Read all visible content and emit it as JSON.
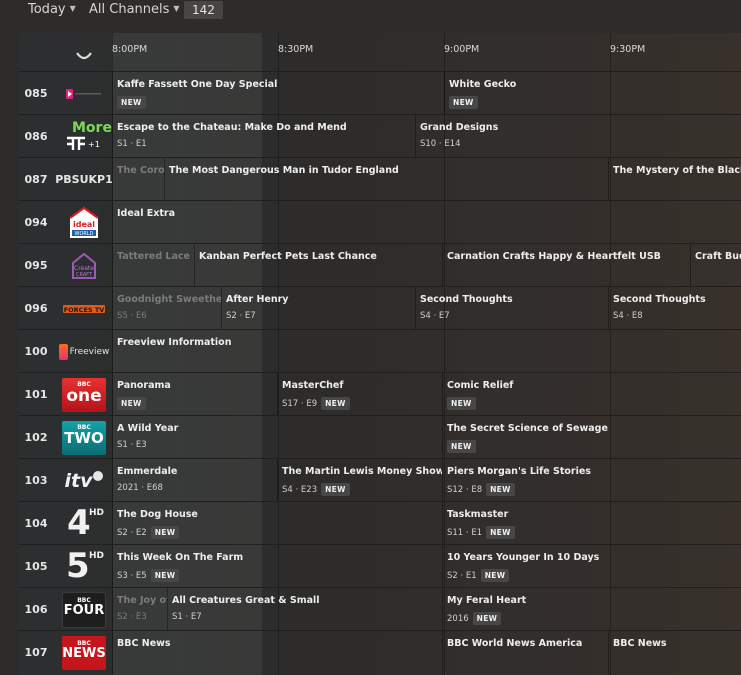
{
  "toolbar": {
    "day_label": "Today",
    "channels_label": "All Channels",
    "channel_count": "142"
  },
  "timeline": [
    "8:00PM",
    "8:30PM",
    "9:00PM",
    "9:30PM"
  ],
  "rows": [
    {
      "number": "085",
      "logo": "pink-channel-logo",
      "programs": [
        {
          "title": "Kaffe Fassett One Day Special",
          "meta": "",
          "badge": "NEW"
        },
        {
          "title": "White Gecko",
          "meta": "",
          "badge": "NEW"
        }
      ]
    },
    {
      "number": "086",
      "logo": "more4-plus1-logo",
      "programs": [
        {
          "title": "Escape to the Chateau: Make Do and Mend",
          "meta": "S1 · E1",
          "badge": ""
        },
        {
          "title": "Grand Designs",
          "meta": "S10 · E14",
          "badge": ""
        }
      ]
    },
    {
      "number": "087",
      "callsign": "PBSUKP1",
      "programs": [
        {
          "title": "The Corona",
          "meta": "",
          "badge": ""
        },
        {
          "title": "The Most Dangerous Man in Tudor England",
          "meta": "",
          "badge": ""
        },
        {
          "title": "The Mystery of the Black Death",
          "meta": "",
          "badge": ""
        }
      ]
    },
    {
      "number": "094",
      "logo": "ideal-world-logo",
      "programs": [
        {
          "title": "Ideal Extra",
          "meta": "",
          "badge": ""
        }
      ]
    },
    {
      "number": "095",
      "logo": "create-and-craft-logo",
      "programs": [
        {
          "title": "Tattered Lace Card",
          "meta": "",
          "badge": ""
        },
        {
          "title": "Kanban Perfect Pets Last Chance",
          "meta": "",
          "badge": ""
        },
        {
          "title": "Carnation Crafts Happy & Heartfelt USB",
          "meta": "",
          "badge": ""
        },
        {
          "title": "Craft Budget",
          "meta": "",
          "badge": ""
        }
      ]
    },
    {
      "number": "096",
      "logo": "forces-tv-logo",
      "programs": [
        {
          "title": "Goodnight Sweetheart",
          "meta": "S5 · E6",
          "badge": ""
        },
        {
          "title": "After Henry",
          "meta": "S2 · E7",
          "badge": ""
        },
        {
          "title": "Second Thoughts",
          "meta": "S4 · E7",
          "badge": ""
        },
        {
          "title": "Second Thoughts",
          "meta": "S4 · E8",
          "badge": ""
        }
      ]
    },
    {
      "number": "100",
      "logo": "freeview-logo",
      "logo_text": "Freeview",
      "programs": [
        {
          "title": "Freeview Information",
          "meta": "",
          "badge": ""
        }
      ]
    },
    {
      "number": "101",
      "logo": "bbc-one-logo",
      "logo_text": "one",
      "programs": [
        {
          "title": "Panorama",
          "meta": "",
          "badge": "NEW"
        },
        {
          "title": "MasterChef",
          "meta": "S17 · E9",
          "badge": "NEW"
        },
        {
          "title": "Comic Relief",
          "meta": "",
          "badge": "NEW"
        }
      ]
    },
    {
      "number": "102",
      "logo": "bbc-two-logo",
      "logo_text": "TWO",
      "programs": [
        {
          "title": "A Wild Year",
          "meta": "S1 · E3",
          "badge": ""
        },
        {
          "title": "The Secret Science of Sewage",
          "meta": "",
          "badge": "NEW"
        }
      ]
    },
    {
      "number": "103",
      "logo": "itv-logo",
      "logo_text": "itv",
      "programs": [
        {
          "title": "Emmerdale",
          "meta": "2021 · E68",
          "badge": ""
        },
        {
          "title": "The Martin Lewis Money Show Live",
          "meta": "S4 · E23",
          "badge": "NEW"
        },
        {
          "title": "Piers Morgan's Life Stories",
          "meta": "S12 · E8",
          "badge": "NEW"
        }
      ]
    },
    {
      "number": "104",
      "logo": "channel-4-hd-logo",
      "logo_text": "4",
      "programs": [
        {
          "title": "The Dog House",
          "meta": "S2 · E2",
          "badge": "NEW"
        },
        {
          "title": "Taskmaster",
          "meta": "S11 · E1",
          "badge": "NEW"
        }
      ]
    },
    {
      "number": "105",
      "logo": "channel-5-hd-logo",
      "logo_text": "5",
      "programs": [
        {
          "title": "This Week On The Farm",
          "meta": "S3 · E5",
          "badge": "NEW"
        },
        {
          "title": "10 Years Younger In 10 Days",
          "meta": "S2 · E1",
          "badge": "NEW"
        }
      ]
    },
    {
      "number": "106",
      "logo": "bbc-four-logo",
      "logo_text": "FOUR",
      "programs": [
        {
          "title": "The Joy of Painting",
          "meta": "S2 · E3",
          "badge": ""
        },
        {
          "title": "All Creatures Great & Small",
          "meta": "S1 · E7",
          "badge": ""
        },
        {
          "title": "My Feral Heart",
          "meta": "2016",
          "badge": "NEW"
        }
      ]
    },
    {
      "number": "107",
      "logo": "bbc-news-logo",
      "logo_text": "NEWS",
      "programs": [
        {
          "title": "BBC News",
          "meta": "",
          "badge": ""
        },
        {
          "title": "BBC World News America",
          "meta": "",
          "badge": ""
        },
        {
          "title": "BBC News",
          "meta": "",
          "badge": ""
        }
      ]
    }
  ]
}
